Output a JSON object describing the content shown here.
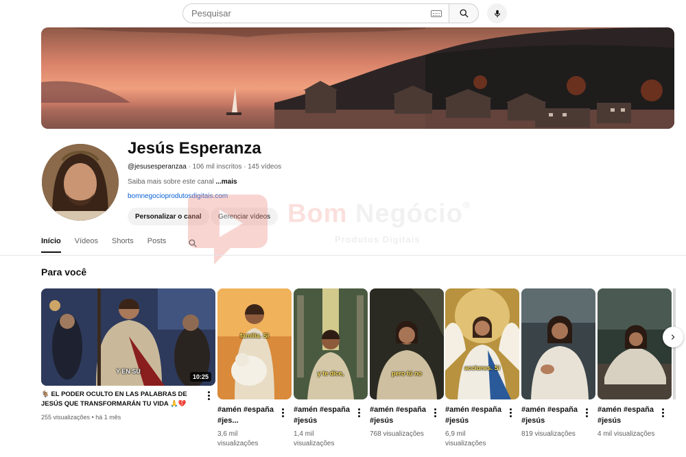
{
  "search": {
    "placeholder": "Pesquisar",
    "keyboard_icon": "keyboard-icon",
    "search_icon": "search-icon",
    "mic_icon": "microphone-icon"
  },
  "channel": {
    "name": "Jesús Esperanza",
    "handle": "@jesusesperanzaa",
    "subscribers": "106 mil inscritos",
    "videos": "145 vídeos",
    "separator": " · ",
    "about": "Saiba mais sobre este canal",
    "about_more": "...mais",
    "link": "bomnegocioprodutosdigitais.com",
    "customize_label": "Personalizar o canal",
    "manage_label": "Gerenciar vídeos"
  },
  "tabs": [
    {
      "label": "Início",
      "active": true
    },
    {
      "label": "Vídeos",
      "active": false
    },
    {
      "label": "Shorts",
      "active": false
    },
    {
      "label": "Posts",
      "active": false
    }
  ],
  "watermark": {
    "brand_a": "Bom ",
    "brand_b": "Negócio",
    "reg": "®",
    "subtitle": "Produtos Digitais"
  },
  "section": {
    "title": "Para você"
  },
  "featured": {
    "title": "🐐 EL PODER OCULTO EN LAS PALABRAS DE JESÚS QUE TRANSFORMARÁN TU VIDA 🙏💔",
    "views": "255 visualizações",
    "age": "há 1 mês",
    "meta_sep": " • ",
    "duration": "10:25",
    "caption": "Y EN SU"
  },
  "shorts": [
    {
      "title": "#amén #españa #jes...",
      "views": "3,6 mil visualizações",
      "caption": "familia. Si"
    },
    {
      "title": "#amén #españa #jesús",
      "views": "1,4 mil visualizações",
      "caption": "y te dice,"
    },
    {
      "title": "#amén #españa #jesús",
      "views": "768 visualizações",
      "caption": "pero tú no"
    },
    {
      "title": "#amén #españa #jesús",
      "views": "6,9 mil visualizações",
      "caption": "acciones. Si"
    },
    {
      "title": "#amén #españa #jesús",
      "views": "819 visualizações",
      "caption": ""
    },
    {
      "title": "#amén #españa #jesús",
      "views": "4 mil visualizações",
      "caption": ""
    }
  ],
  "colors": {
    "link": "#065fd4",
    "text": "#0f0f0f",
    "muted": "#606060",
    "pill": "#f2f2f2"
  }
}
